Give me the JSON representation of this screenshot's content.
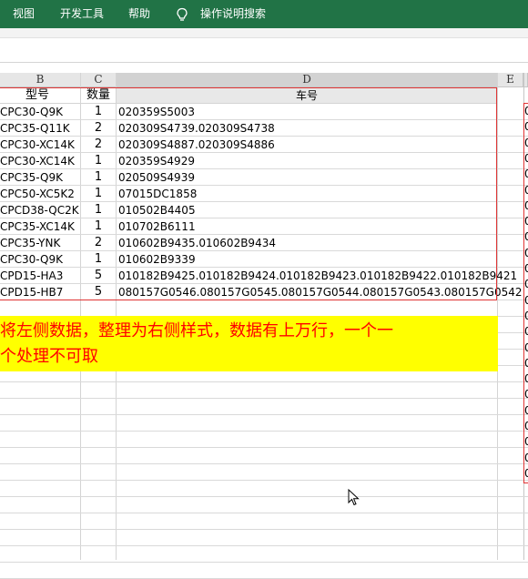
{
  "ribbon": {
    "tabs": [
      "视图",
      "开发工具",
      "帮助"
    ],
    "tell_me": "操作说明搜索",
    "bg_color": "#217346"
  },
  "columns": [
    "B",
    "C",
    "D",
    "E"
  ],
  "headers": {
    "model": "型号",
    "qty": "数量",
    "vehicle": "车号"
  },
  "rows": [
    {
      "model": "CPC30-Q9K",
      "qty": "1",
      "vehicle": "020359S5003"
    },
    {
      "model": "CPC35-Q11K",
      "qty": "2",
      "vehicle": "020309S4739.020309S4738"
    },
    {
      "model": "CPC30-XC14K",
      "qty": "2",
      "vehicle": "020309S4887.020309S4886"
    },
    {
      "model": "CPC30-XC14K",
      "qty": "1",
      "vehicle": "020359S4929"
    },
    {
      "model": "CPC35-Q9K",
      "qty": "1",
      "vehicle": "020509S4939"
    },
    {
      "model": "CPC50-XC5K2",
      "qty": "1",
      "vehicle": "07015DC1858"
    },
    {
      "model": "CPCD38-QC2K",
      "qty": "1",
      "vehicle": "010502B4405"
    },
    {
      "model": "CPC35-XC14K",
      "qty": "1",
      "vehicle": "010702B6111"
    },
    {
      "model": "CPC35-YNK",
      "qty": "2",
      "vehicle": "010602B9435.010602B9434"
    },
    {
      "model": "CPC30-Q9K",
      "qty": "1",
      "vehicle": "010602B9339"
    },
    {
      "model": "CPD15-HA3",
      "qty": "5",
      "vehicle": "010182B9425.010182B9424.010182B9423.010182B9422.010182B9421"
    },
    {
      "model": "CPD15-HB7",
      "qty": "5",
      "vehicle": "080157G0546.080157G0545.080157G0544.080157G0543.080157G0542"
    }
  ],
  "note_lines": [
    "将左侧数据，整理为右侧样式，数据有上万行，一个一",
    "个处理不可取"
  ],
  "f_column_values": [
    "0",
    "0",
    "0",
    "0",
    "0",
    "0",
    "0",
    "0",
    "0",
    "0",
    "0",
    "0",
    "0",
    "0",
    "0",
    "0",
    "0",
    "0",
    "0",
    "0",
    "0",
    "0",
    "0",
    "0"
  ],
  "colors": {
    "note_bg": "#ffff00",
    "note_text": "#ff0000",
    "border_red": "#e03434"
  }
}
